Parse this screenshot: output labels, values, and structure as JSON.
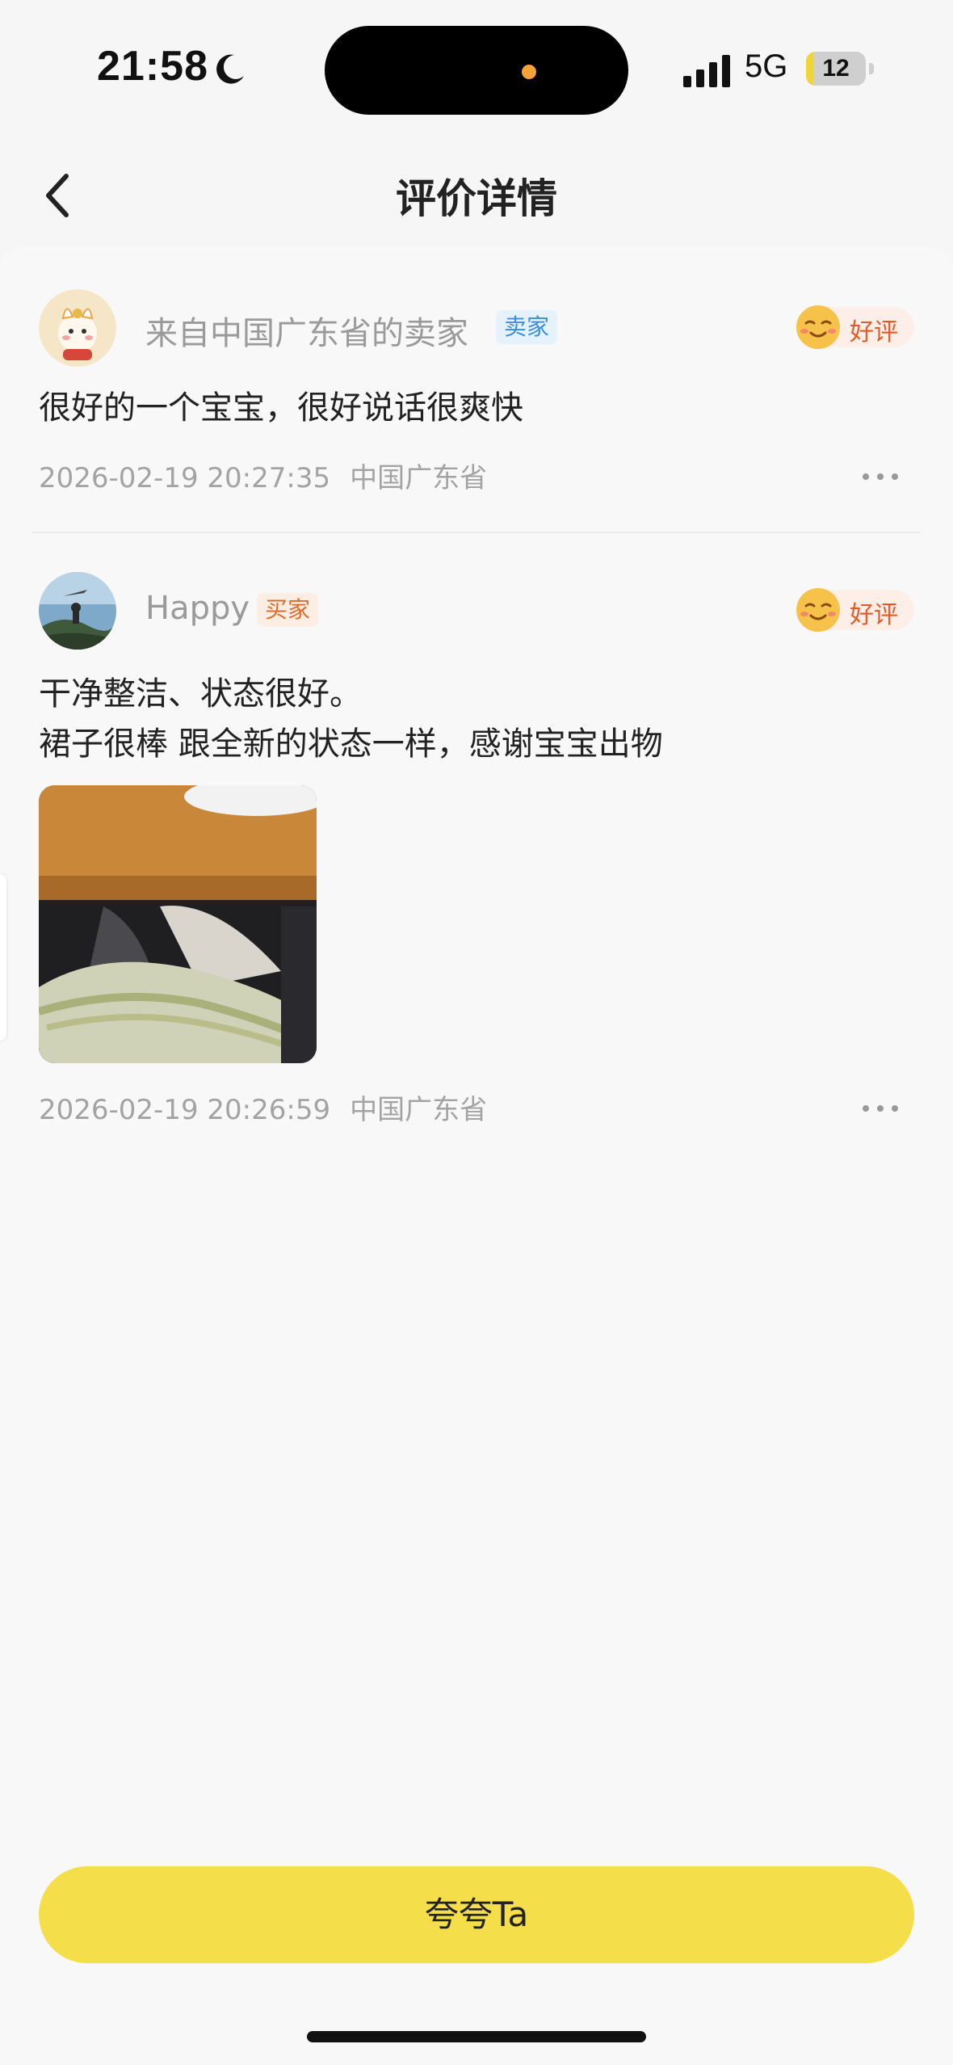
{
  "status_bar": {
    "time": "21:58",
    "network": "5G",
    "battery_level": "12",
    "battery_fraction": 0.12,
    "accent_color": "#f1d33a"
  },
  "nav": {
    "back_icon": "chevron-left-icon",
    "title": "评价详情"
  },
  "reviews": [
    {
      "username": "来自中国广东省的卖家",
      "role_tag": "卖家",
      "rating_label": "好评",
      "text_lines": [
        "很好的一个宝宝，很好说话很爽快"
      ],
      "timestamp": "2026-02-19 20:27:35",
      "location": "中国广东省",
      "more_icon": "more-horizontal-icon"
    },
    {
      "username": "Happy",
      "role_tag": "买家",
      "rating_label": "好评",
      "text_lines": [
        "干净整洁、状态很好。",
        "裙子很棒 跟全新的状态一样，感谢宝宝出物"
      ],
      "timestamp": "2026-02-19 20:26:59",
      "location": "中国广东省",
      "more_icon": "more-horizontal-icon"
    }
  ],
  "actions": {
    "praise_label": "夸夸Ta",
    "praise_color": "#f4df4a"
  }
}
